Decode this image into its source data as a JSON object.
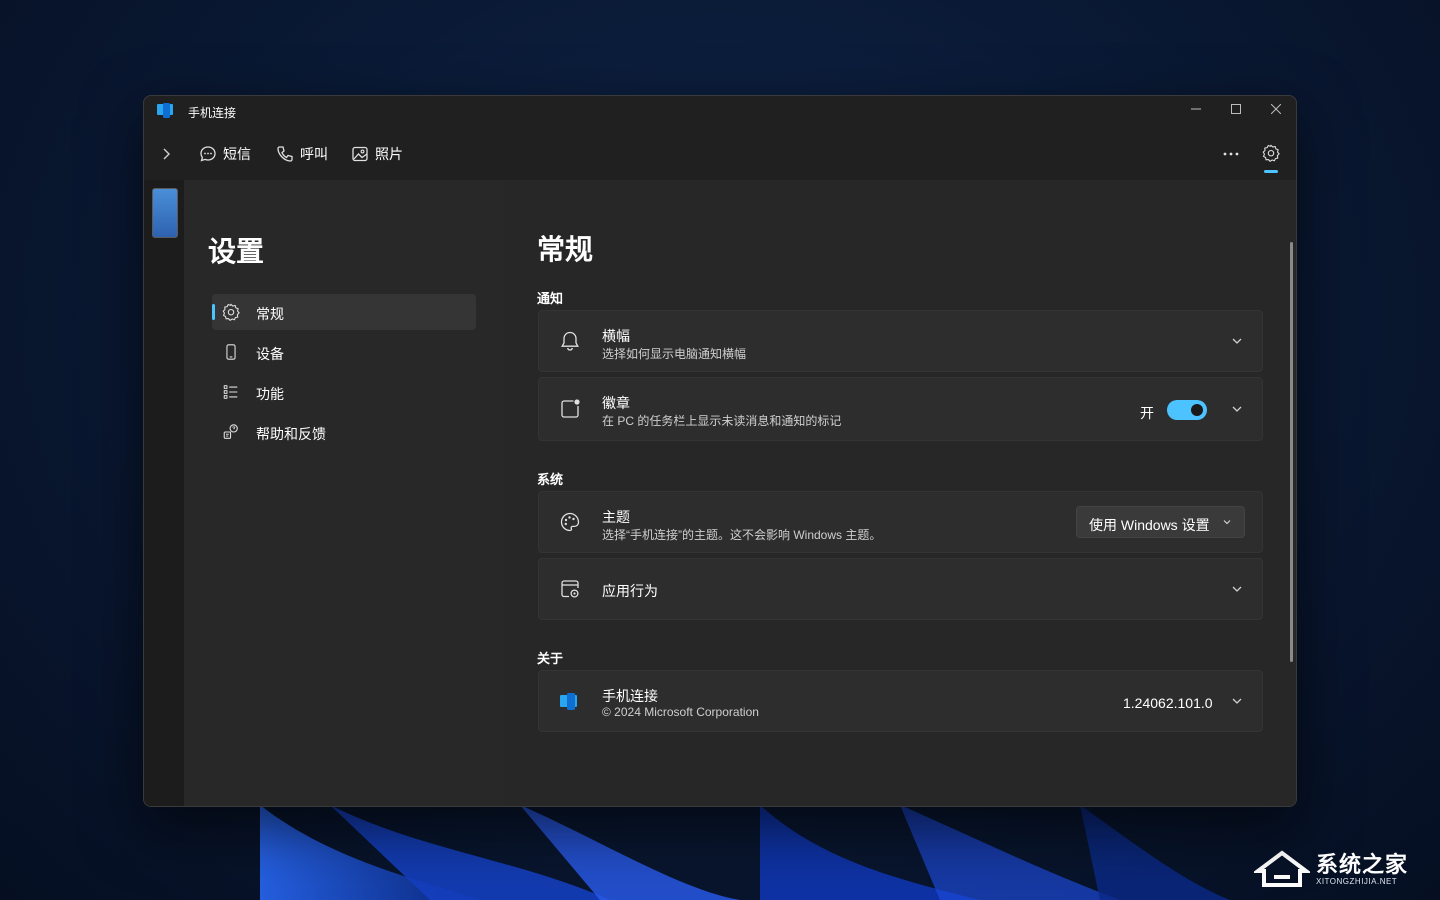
{
  "window": {
    "title": "手机连接"
  },
  "nav": {
    "tabs": [
      {
        "label": "短信",
        "icon": "chat-icon"
      },
      {
        "label": "呼叫",
        "icon": "phone-icon"
      },
      {
        "label": "照片",
        "icon": "photo-icon"
      }
    ]
  },
  "sidebar": {
    "title": "设置",
    "items": [
      {
        "label": "常规",
        "icon": "gear-icon",
        "active": true
      },
      {
        "label": "设备",
        "icon": "mobile-device-icon"
      },
      {
        "label": "功能",
        "icon": "list-icon"
      },
      {
        "label": "帮助和反馈",
        "icon": "help-feedback-icon"
      }
    ]
  },
  "content": {
    "title": "常规",
    "sections": {
      "notify": "通知",
      "system": "系统",
      "about": "关于"
    },
    "banner": {
      "title": "横幅",
      "subtitle": "选择如何显示电脑通知横幅"
    },
    "badge": {
      "title": "徽章",
      "subtitle": "在 PC 的任务栏上显示未读消息和通知的标记",
      "toggle_label": "开",
      "toggle_on": true
    },
    "theme": {
      "title": "主题",
      "subtitle": "选择“手机连接”的主题。这不会影响 Windows 主题。",
      "dropdown_value": "使用 Windows 设置"
    },
    "app_behavior": {
      "title": "应用行为"
    },
    "about_card": {
      "title": "手机连接",
      "subtitle": "© 2024 Microsoft Corporation",
      "version": "1.24062.101.0"
    }
  },
  "watermark": {
    "text": "系统之家",
    "subtext": "XITONGZHIJIA.NET"
  },
  "colors": {
    "accent": "#4cc2ff",
    "window_bg": "#202020",
    "card_bg": "#2d2d2d"
  }
}
